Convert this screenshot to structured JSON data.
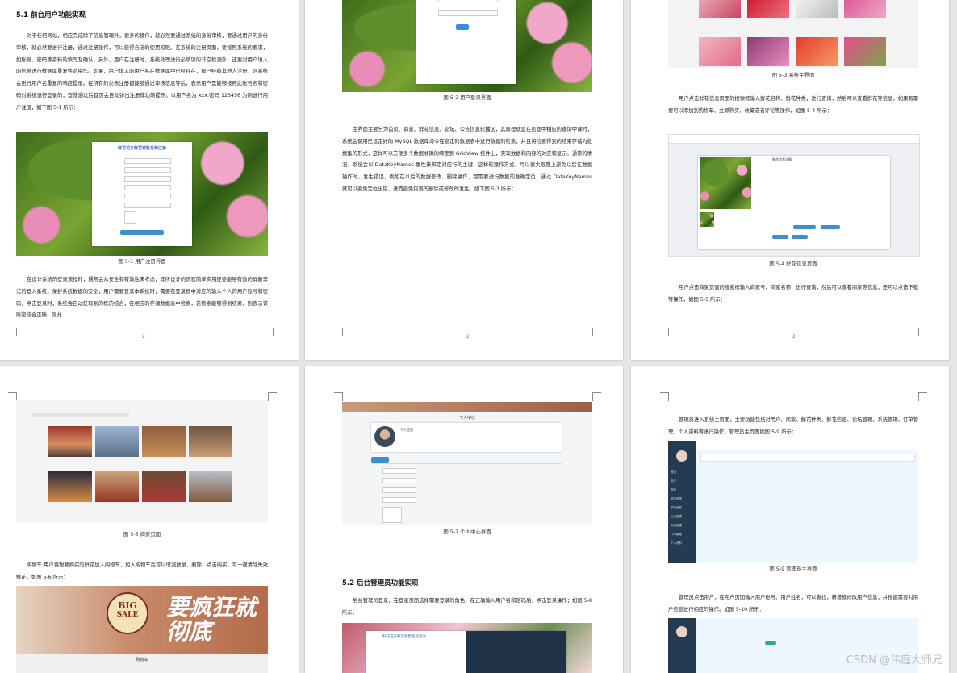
{
  "pages": {
    "p1": {
      "heading": "5.1 前台用户功能实现",
      "para1": "对于任何网站，相应完成除了信息管理外，更多的操作，就必然要通过系统的身份审核，要通过用户的身份审核，就必然要进行注册，通过注册操作，可以获得合法的使用权限。在系统的注册页面，要按照系统的要求，如账号、密码等资料的填写及确认。另外，用户在注册时，系统处理进行必填项的非空检测外，还要对用户填入的信息进行数据库重复性对操作。如果，用户填入的用户名在数据库中已经存在，那已经被其他人注册，则系统会进行用户名重复的响应提示。在所有的类表注册都能够通过审核信息等后，表示用户是能够按照此账号名和密码对系统进行登录的，登陆通过后首页会自动弹出注册成功的提示。以用户名为 xxx,密码 123456 为例进行用户注册，如下图 5-1 所示：",
      "fig_title": "鲜花花卉鲜花销售系统注册",
      "caption": "图 5-1 用户注册界面",
      "para2": "在设计系统的登录流程时，通常会从安全和有效性来考虑，即所设计的流程简单实用还要能够有效的屏蔽非法的登入系统，保护系统数据的安全，用户需要登录本系统时，需要在登录框中对应的输入个人的用户账号和密码，点击登录时，系统会自动获取到的框的结合，在相应的存储数据表中检索，若检索能够得到结果，则表示该账密结合正确，则允",
      "page_no": "2"
    },
    "p2": {
      "caption": "图 5-2 用户登录界面",
      "para": "主界面主要分为首页、商家、鲜花信息、论坛、公告信息轮播区，其原理就是在页面中相应的查询中课时，系统会调用已设定好的 MySQL 数据库命令在指定的数据表中进行数据的检索，并且将检索得到的结果存储为数据集的形式，这样可以方便多个数据准确的绑定到 GridView 控件上，实现数据和内容的对应和显示。通常的情况，系统会以 DataKeyNames 属性来绑定对应行的主键，这样的操作方式，可以很大限度上避免以后在数据操作时，发生错误，例如在以后的数据修改、删除操作，都需要进行数据的准确定位，通过 DataKeyNames 就可以避免定位出错，进而避免错误的删除或修改的发生。如下图 5-3 所示：",
      "page_no": "2",
      "login_label": "登录",
      "login_button": "登录"
    },
    "p3": {
      "caption": "图 5-3 系统主界面",
      "para1": "用户点击鲜花信息页面的搜索框输入鲜花名称、鲜花种类，进行查询，然后可以查看鲜花等信息，如果有需要可以添加到购物车、立即购买、收藏或者评论等操作，如图 5-4 所示：",
      "caption2": "图 5-4 鲜花信息页面",
      "para2": "用户点击商家页面的搜索框输入商家号、商家名称，进行查询，然后可以查看商家等信息，还可以点击下载等操作，如图 5-5 所示：",
      "page_no": "2",
      "detail_title": "鲜花信息详情"
    },
    "p4": {
      "caption": "图 5-5 商家页面",
      "para": "购物车:用户将想要购买的鲜花加入购物车，加入购物车后可以增减数量、删除，点击购买，可一键清除失效鲜花，如图 5-6 所示：",
      "banner_big": "BIG",
      "banner_sale": "SALE",
      "banner_text": "要疯狂就彻底",
      "cart_label": "购物车"
    },
    "p5": {
      "caption": "图 5-7 个人中心界面",
      "heading": "5.2 后台管理员功能实现",
      "para": "后台管理员登录，在登录页面选择需要登录的角色，在正确输入用户名和密码后，点击登录操作；如图 5-8 所示。",
      "center_title": "个人中心",
      "user_name": "个人信息",
      "fig_title": "鲜花花卉鲜花销售系统登录"
    },
    "p6": {
      "para1": "管理员进入系统主页面，主要功能包括对用户、商家、鲜花种类、鲜花信息、论坛管理、系统管理、订单管理、个人资料等进行操作。管理员主页面如图 5-9 所示：",
      "caption": "图 5-9 管理员主界面",
      "para2": "管理员点击用户，在用户页面输入用户账号、用户姓名，可以查找，新增或修改用户信息，并根据需要对用户信息进行相应的操作。如图 5-10 所示：",
      "sidebar_title": "鲜花花卉鲜花销售系统",
      "menu": [
        "首页",
        "用户",
        "商家",
        "鲜花种类",
        "鲜花信息",
        "论坛管理",
        "系统管理",
        "订单管理",
        "个人资料"
      ]
    }
  },
  "watermark": "CSDN @伟庭大师兄"
}
